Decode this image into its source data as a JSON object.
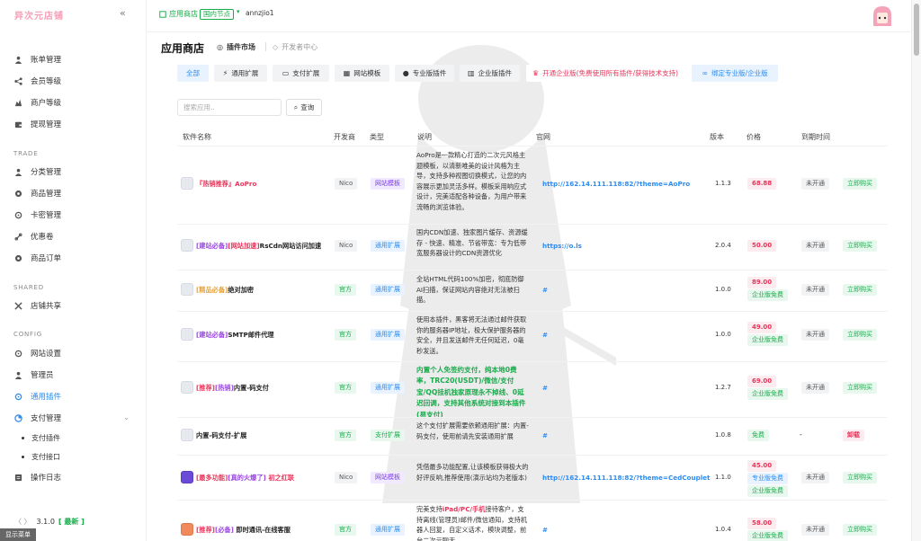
{
  "sidebar": {
    "brand": "异次元店铺",
    "sections": {
      "trade": "TRADE",
      "shared": "SHARED",
      "config": "CONFIG"
    },
    "items": {
      "bill": "账单管理",
      "member_level": "会员等级",
      "merchant_level": "商户等级",
      "withdraw": "提现管理",
      "category": "分类管理",
      "goods": "商品管理",
      "cardkey": "卡密管理",
      "coupon": "优惠卷",
      "orders": "商品订单",
      "store_share": "店铺共享",
      "site_settings": "网站设置",
      "admin": "管理员",
      "plugins": "通用插件",
      "payment": "支付管理",
      "pay_plugins": "支付插件",
      "pay_api": "支付接口",
      "logs": "操作日志"
    },
    "version": {
      "code": "〈 〉",
      "number": "3.1.0",
      "latest": "[ 最新 ]"
    },
    "show_menu": "显示菜单"
  },
  "topbar": {
    "store": "应用商店",
    "node": "国内节点",
    "user": "annzjio1"
  },
  "page": {
    "title": "应用商店",
    "tab_market": "插件市场",
    "tab_dev": "开发者中心"
  },
  "categories": {
    "all": "全部",
    "general": "通用扩展",
    "payment": "支付扩展",
    "template": "网站模板",
    "pro": "专业版插件",
    "enterprise": "企业版插件",
    "vip": "开通企业版(免费使用所有插件/获得技术支持)",
    "bind": "绑定专业版/企业版"
  },
  "search": {
    "placeholder": "搜索应用..",
    "button": "查询"
  },
  "table": {
    "headers": {
      "name": "软件名称",
      "dev": "开发商",
      "type": "类型",
      "desc": "说明",
      "site": "官网",
      "version": "版本",
      "price": "价格",
      "expire": "到期时间"
    },
    "rows": [
      {
        "tag1": "『热销推荐』",
        "title": "AoPro",
        "dev": "Nico",
        "type": "网站模板",
        "desc": "AoPro是一款精心打造的二次元风格主题模板，以清新唯美的设计风格为主导，支持多种视图切换模式，让您的内容展示更加灵活多样。模板采用响应式设计，完美适配各种设备，为用户带来流畅的浏览体验。",
        "site": "http://162.14.111.118:82/?theme=AoPro",
        "version": "1.1.3",
        "price": "68.88",
        "status": "未开通",
        "action": "立即购买"
      },
      {
        "tag1": "[建站必备]",
        "tag2": "[网站加速]",
        "title": "RsCdn网站访问加速",
        "dev": "Nico",
        "type": "通用扩展",
        "desc": "国内CDN加速、独家图片缓存、资源缓存 - 快速、精准、节省带宽：专为低带宽服务器设计的CDN资源优化",
        "site": "https://o.ls",
        "version": "2.0.4",
        "price": "50.00",
        "status": "未开通",
        "action": "立即购买"
      },
      {
        "tag1": "[精品必备]",
        "title": "绝对加密",
        "dev": "官方",
        "type": "通用扩展",
        "desc": "全站HTML代码100%加密，彻底防御AI扫描，保证网站内容绝对无法被扫描。",
        "site": "#",
        "version": "1.0.0",
        "price": "89.00",
        "free": "企业版免费",
        "status": "未开通",
        "action": "立即购买"
      },
      {
        "tag1": "[建站必备]",
        "title": "SMTP邮件代理",
        "dev": "官方",
        "type": "通用扩展",
        "desc": "使用本插件，黑客将无法通过邮件获取你的服务器IP地址，极大保护服务器的安全，并且发送邮件无任何延迟，0毫秒发送。",
        "site": "#",
        "version": "1.0.0",
        "price": "49.00",
        "free": "企业版免费",
        "status": "未开通",
        "action": "立即购买"
      },
      {
        "tag1": "[推荐]",
        "tag2": "[热销]",
        "title": "内置-码支付",
        "dev": "官方",
        "type": "通用扩展",
        "desc": "内置个人免签约支付，纯本地0费率，TRC20(USDT)/微信/支付宝/QQ挂机独家原理永不掉线、0延迟回调，支持其他系统对接到本插件(易支付)",
        "site": "#",
        "version": "1.2.7",
        "price": "69.00",
        "free": "企业版免费",
        "status": "未开通",
        "action": "立即购买"
      },
      {
        "title": "内置-码支付-扩展",
        "dev": "官方",
        "type": "支付扩展",
        "desc": "这个支付扩展需要依赖通用扩展：内置-码支付，使用前请先安装通用扩展",
        "site": "#",
        "version": "1.0.8",
        "price": "免费",
        "status": "-",
        "action": "卸载"
      },
      {
        "tag1": "[最多功能]",
        "tag2": "[真的火爆了]",
        "title": "初之红联",
        "dev": "Nico",
        "type": "网站模板",
        "desc": "凭借最多功能配置,让该模板获得极大的好评反响,推荐使用(演示站均为老版本)",
        "site": "http://162.14.111.118:82/?theme=CedCouplet",
        "version": "1.1.0",
        "price": "45.00",
        "free": "专业版免费",
        "free2": "企业版免费",
        "status": "未开通",
        "action": "立即购买"
      },
      {
        "tag1": "[推荐]",
        "tag2": "[必备]",
        "title": "即时通讯-在线客服",
        "dev": "官方",
        "type": "通用扩展",
        "desc_a": "完美支持",
        "desc_em": "iPad/PC/手机",
        "desc_b": "接待客户，支持离线(管理员)邮件/微信通知，支持机器人回复，自定义话术，模块调整，前台二次元聊天",
        "site": "#",
        "version": "1.0.4",
        "price": "58.00",
        "free": "企业版免费",
        "status": "未开通",
        "action": "立即购买"
      }
    ]
  }
}
